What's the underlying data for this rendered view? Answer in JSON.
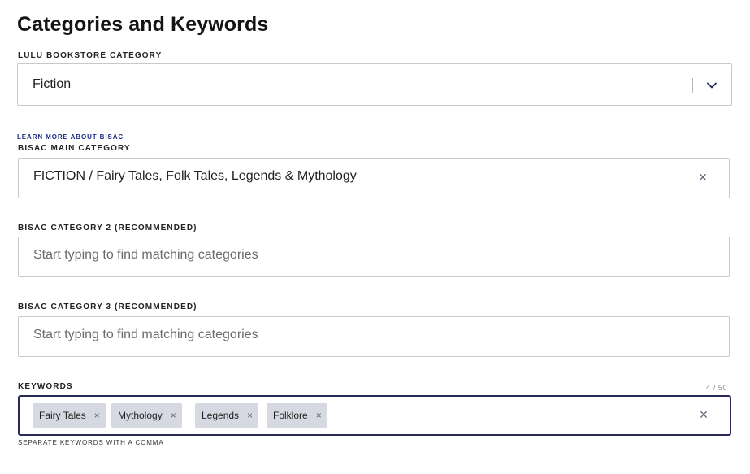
{
  "page_title": "Categories and Keywords",
  "bookstore": {
    "label": "Lulu Bookstore Category",
    "selected": "Fiction",
    "icon": "chevron-down-icon"
  },
  "bisac_link": "Learn more about BISAC",
  "bisac_main": {
    "label": "BISAC Main Category",
    "value": "FICTION / Fairy Tales, Folk Tales, Legends & Mythology",
    "clear_icon": "×"
  },
  "bisac_2": {
    "label": "BISAC Category 2 (Recommended)",
    "placeholder": "Start typing to find matching categories"
  },
  "bisac_3": {
    "label": "BISAC Category 3 (Recommended)",
    "placeholder": "Start typing to find matching categories"
  },
  "keywords": {
    "label": "Keywords",
    "counter": "4 / 50",
    "chips": [
      "Fairy Tales",
      "Mythology",
      "Legends",
      "Folklore"
    ],
    "chip_remove": "×",
    "clear_icon": "×",
    "helper": "Separate keywords with a comma"
  },
  "colors": {
    "focus_border": "#2a2a5a",
    "link": "#1c2f86",
    "chip_bg": "#d6d9e2"
  }
}
